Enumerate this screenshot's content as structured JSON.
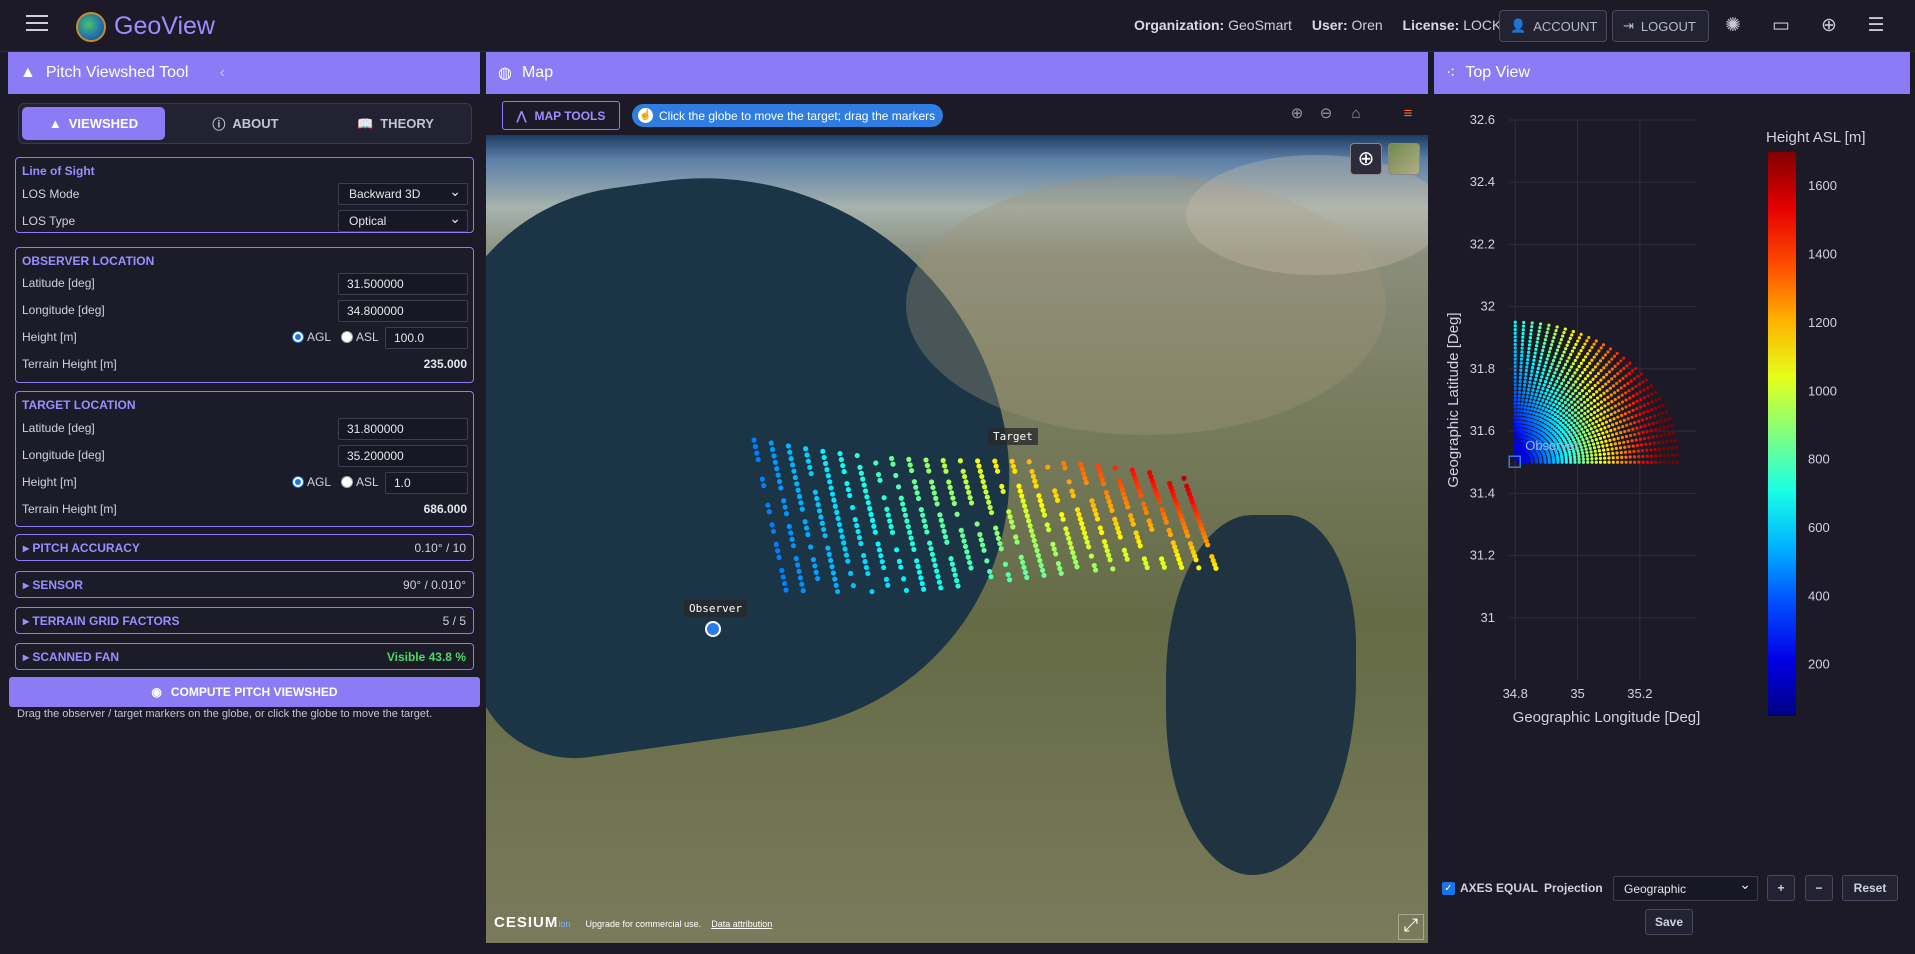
{
  "app": {
    "title": "GeoView"
  },
  "header": {
    "org_label": "Organization:",
    "org_value": "GeoSmart",
    "user_label": "User:",
    "user_value": "Oren",
    "license_label": "License:",
    "license_value": "LOCKED",
    "account_label": "ACCOUNT",
    "logout_label": "LOGOUT"
  },
  "left": {
    "title": "Pitch Viewshed Tool",
    "tabs": [
      {
        "label": "VIEWSHED"
      },
      {
        "label": "ABOUT"
      },
      {
        "label": "THEORY"
      }
    ],
    "los": {
      "title": "Line of Sight",
      "mode_label": "LOS Mode",
      "mode_value": "Backward 3D",
      "type_label": "LOS Type",
      "type_value": "Optical"
    },
    "observer": {
      "title": "OBSERVER LOCATION",
      "lat_label": "Latitude [deg]",
      "lat_value": "31.500000",
      "lon_label": "Longitude [deg]",
      "lon_value": "34.800000",
      "height_label": "Height [m]",
      "agl": "AGL",
      "asl": "ASL",
      "height_value": "100.0",
      "terrain_label": "Terrain Height [m]",
      "terrain_value": "235.000"
    },
    "target": {
      "title": "TARGET LOCATION",
      "lat_label": "Latitude [deg]",
      "lat_value": "31.800000",
      "lon_label": "Longitude [deg]",
      "lon_value": "35.200000",
      "height_label": "Height [m]",
      "agl": "AGL",
      "asl": "ASL",
      "height_value": "1.0",
      "terrain_label": "Terrain Height [m]",
      "terrain_value": "686.000"
    },
    "sections": [
      {
        "label": "PITCH ACCURACY",
        "value": "0.10° / 10"
      },
      {
        "label": "SENSOR",
        "value": "90° / 0.010°"
      },
      {
        "label": "TERRAIN GRID FACTORS",
        "value": "5 / 5"
      },
      {
        "label": "SCANNED FAN",
        "value": "Visible 43.8 %"
      }
    ],
    "compute_label": "COMPUTE PITCH VIEWSHED",
    "hint": "Drag the observer / target markers on the globe, or click the globe to move the target."
  },
  "map": {
    "title": "Map",
    "tools_label": "MAP TOOLS",
    "hint": "Click the globe to move the target; drag the markers",
    "target_label": "Target",
    "observer_label": "Observer",
    "cesium_brand": "CESIUM",
    "cesium_ion": "ion",
    "upgrade": "Upgrade for commercial use.",
    "attribution": "Data attribution"
  },
  "topview": {
    "title": "Top View",
    "axes_equal": "AXES EQUAL",
    "projection_label": "Projection",
    "projection_value": "Geographic",
    "plus": "+",
    "minus": "−",
    "reset": "Reset",
    "save": "Save"
  },
  "chart_data": {
    "type": "scatter",
    "title": "",
    "xlabel": "Geographic Longitude [Deg]",
    "ylabel": "Geographic Latitude [Deg]",
    "xlim": [
      34.78,
      35.38
    ],
    "ylim": [
      30.8,
      32.6
    ],
    "xticks": [
      "34.8",
      "35",
      "35.2"
    ],
    "yticks": [
      "31",
      "31.2",
      "31.4",
      "31.6",
      "31.8",
      "32",
      "32.2",
      "32.4",
      "32.6"
    ],
    "colorbar": {
      "title": "Height ASL [m]",
      "ticks": [
        "200",
        "400",
        "600",
        "800",
        "1000",
        "1200",
        "1400",
        "1600"
      ],
      "min": 50,
      "max": 1700
    },
    "observer": {
      "x": 34.8,
      "y": 31.5,
      "label": "Observer"
    },
    "fan": {
      "azimuth_from_deg": 0,
      "azimuth_to_deg": 90,
      "lon_span": 0.52,
      "lat_span": 0.45
    },
    "grid": true
  }
}
